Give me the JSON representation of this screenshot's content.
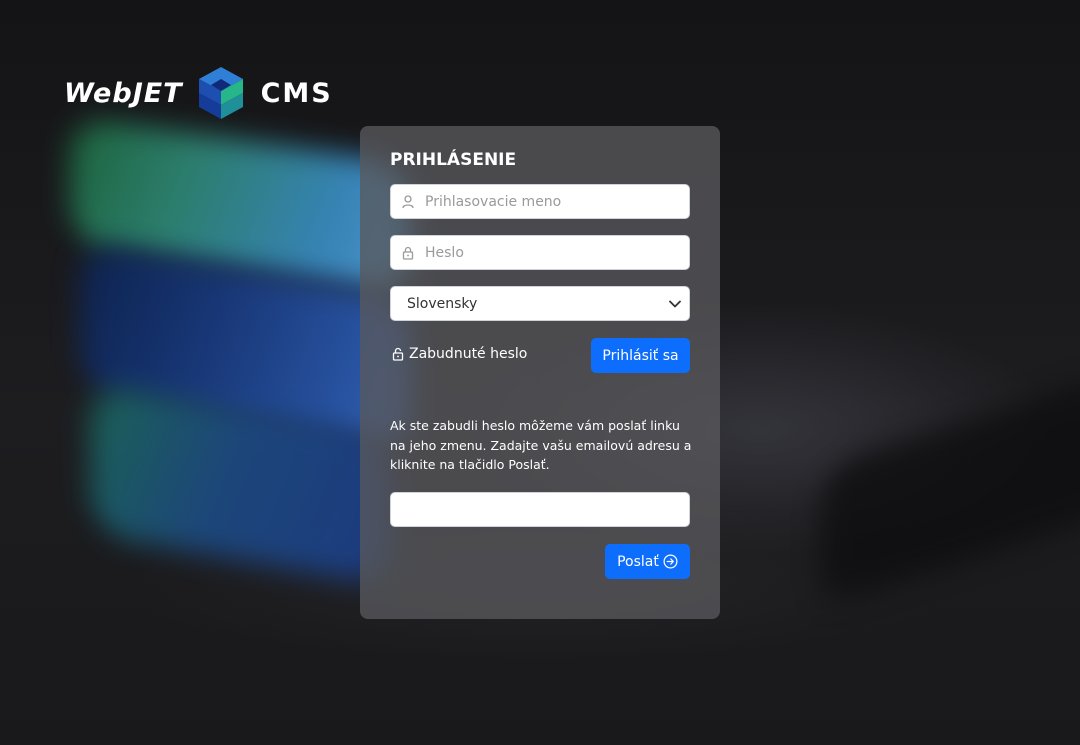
{
  "brand": {
    "word_left": "WebJET",
    "word_right": "CMS"
  },
  "login": {
    "title": "PRIHLÁSENIE",
    "username_placeholder": "Prihlasovacie meno",
    "password_placeholder": "Heslo",
    "language_selected": "Slovensky",
    "forgot_label": "Zabudnuté heslo",
    "submit_label": "Prihlásiť sa"
  },
  "recovery": {
    "help_text": "Ak ste zabudli heslo môžeme vám poslať linku na jeho zmenu. Zadajte vašu emailovú adresu a kliknite na tlačidlo Poslať.",
    "email_value": "",
    "send_label": "Poslať"
  },
  "icons": {
    "user": "user-icon",
    "lock": "lock-icon",
    "unlock": "unlock-icon",
    "chevron": "chevron-down-icon",
    "arrow": "arrow-circle-right-icon"
  },
  "colors": {
    "primary": "#0d6efd",
    "panel": "#58585c"
  }
}
